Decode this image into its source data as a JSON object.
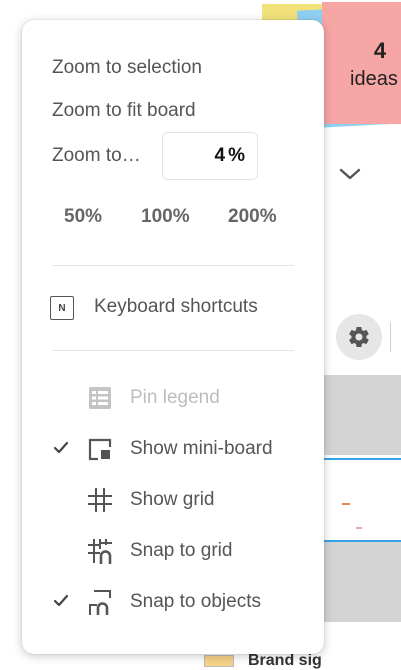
{
  "background": {
    "sticky_count": "4",
    "sticky_label": "ideas",
    "bottom_text": "Brand sig"
  },
  "menu": {
    "zoom_to_selection": "Zoom to selection",
    "zoom_to_fit": "Zoom to fit board",
    "zoom_to_label": "Zoom to…",
    "zoom_value": "4",
    "zoom_unit": "%",
    "presets": [
      "50%",
      "100%",
      "200%"
    ],
    "keyboard_shortcuts_key": "N",
    "keyboard_shortcuts": "Keyboard shortcuts",
    "options": [
      {
        "label": "Pin legend",
        "checked": false,
        "disabled": true,
        "icon": "legend-icon"
      },
      {
        "label": "Show mini-board",
        "checked": true,
        "disabled": false,
        "icon": "mini-board-icon"
      },
      {
        "label": "Show grid",
        "checked": false,
        "disabled": false,
        "icon": "grid-icon"
      },
      {
        "label": "Snap to grid",
        "checked": false,
        "disabled": false,
        "icon": "snap-to-grid-icon"
      },
      {
        "label": "Snap to objects",
        "checked": true,
        "disabled": false,
        "icon": "snap-to-objects-icon"
      }
    ]
  },
  "colors": {
    "accent_blue": "#33a3e6",
    "sticky_pink": "#f7a6a6",
    "sticky_blue": "#8fd0f2",
    "sticky_yellow": "#f2e27a"
  }
}
